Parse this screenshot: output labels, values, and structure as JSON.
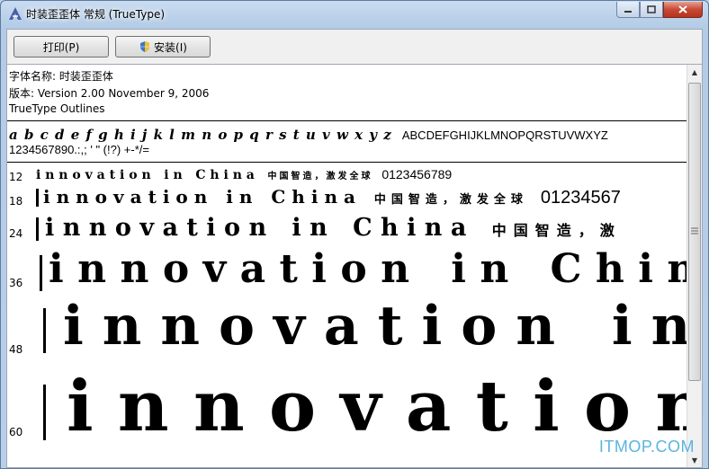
{
  "window": {
    "title": "时装歪歪体 常规 (TrueType)"
  },
  "toolbar": {
    "print_label": "打印(P)",
    "install_label": "安装(I)"
  },
  "info": {
    "font_name": "字体名称: 时装歪歪体",
    "version": "版本: Version 2.00 November 9, 2006",
    "outline_type": "TrueType Outlines"
  },
  "charset": {
    "lowercase": "a b c d e f g h i j k l m n o p q r s t u v w x y z",
    "uppercase": "ABCDEFGHIJKLMNOPQRSTUVWXYZ",
    "digits_symbols": "1234567890.:,; ' \" (!?) +-*/="
  },
  "samples": [
    {
      "size": "12",
      "text": "innovation in China",
      "cjk": "中国智造，激发全球",
      "digits": "0123456789"
    },
    {
      "size": "18",
      "text": "innovation in China",
      "cjk": "中国智造，激发全球",
      "digits": "01234567"
    },
    {
      "size": "24",
      "text": "innovation in China",
      "cjk": "中国智造，激"
    },
    {
      "size": "36",
      "text": "innovation in Chin"
    },
    {
      "size": "48",
      "text": "innovation in"
    },
    {
      "size": "60",
      "text": "innovation"
    }
  ],
  "watermark": "ITMOP.COM"
}
